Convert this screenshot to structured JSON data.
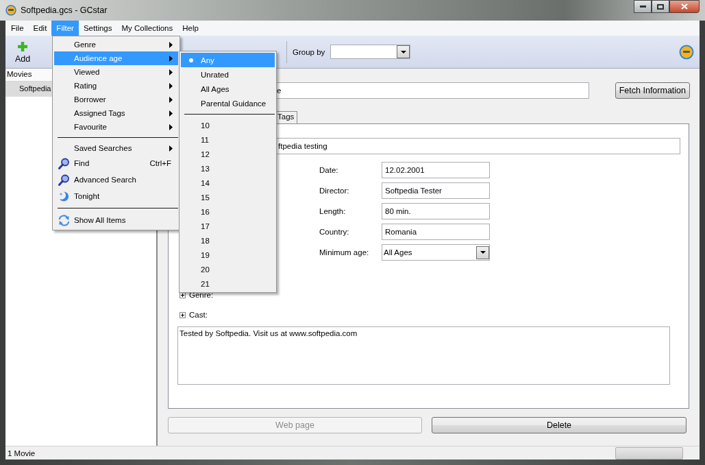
{
  "window": {
    "title": "Softpedia.gcs - GCstar"
  },
  "menu_bar": [
    {
      "label": "File",
      "selected": false
    },
    {
      "label": "Edit",
      "selected": false
    },
    {
      "label": "Filter",
      "selected": true
    },
    {
      "label": "Settings",
      "selected": false
    },
    {
      "label": "My Collections",
      "selected": false
    },
    {
      "label": "Help",
      "selected": false
    }
  ],
  "toolbar": {
    "add_label": "Add",
    "group_by_label": "Group by"
  },
  "sidebar": {
    "header": "Movies",
    "items": [
      {
        "label": "Softpedia",
        "selected": true
      }
    ]
  },
  "filter_menu": [
    {
      "kind": "submenu",
      "label": "Genre",
      "selected": false
    },
    {
      "kind": "submenu",
      "label": "Audience age",
      "selected": true
    },
    {
      "kind": "submenu",
      "label": "Viewed",
      "selected": false
    },
    {
      "kind": "submenu",
      "label": "Rating",
      "selected": false
    },
    {
      "kind": "submenu",
      "label": "Borrower",
      "selected": false
    },
    {
      "kind": "submenu",
      "label": "Assigned Tags",
      "selected": false
    },
    {
      "kind": "submenu",
      "label": "Favourite",
      "selected": false
    },
    {
      "kind": "separator"
    },
    {
      "kind": "submenu",
      "label": "Saved Searches",
      "selected": false
    },
    {
      "kind": "action",
      "label": "Find",
      "shortcut": "Ctrl+F",
      "selected": false
    },
    {
      "kind": "action",
      "label": "Advanced Search",
      "selected": false
    },
    {
      "kind": "action",
      "label": "Tonight",
      "selected": false
    },
    {
      "kind": "separator"
    },
    {
      "kind": "action",
      "label": "Show All Items",
      "selected": false
    }
  ],
  "age_submenu": [
    {
      "kind": "radio",
      "label": "Any",
      "selected": true
    },
    {
      "kind": "radio",
      "label": "Unrated",
      "selected": false
    },
    {
      "kind": "radio",
      "label": "All Ages",
      "selected": false
    },
    {
      "kind": "radio",
      "label": "Parental Guidance",
      "selected": false
    },
    {
      "kind": "separator"
    },
    {
      "kind": "radio",
      "label": "10",
      "selected": false
    },
    {
      "kind": "radio",
      "label": "11",
      "selected": false
    },
    {
      "kind": "radio",
      "label": "12",
      "selected": false
    },
    {
      "kind": "radio",
      "label": "13",
      "selected": false
    },
    {
      "kind": "radio",
      "label": "14",
      "selected": false
    },
    {
      "kind": "radio",
      "label": "15",
      "selected": false
    },
    {
      "kind": "radio",
      "label": "16",
      "selected": false
    },
    {
      "kind": "radio",
      "label": "17",
      "selected": false
    },
    {
      "kind": "radio",
      "label": "18",
      "selected": false
    },
    {
      "kind": "radio",
      "label": "19",
      "selected": false
    },
    {
      "kind": "radio",
      "label": "20",
      "selected": false
    },
    {
      "kind": "radio",
      "label": "21",
      "selected": false
    }
  ],
  "details": {
    "title_value": "e",
    "fetch_button": "Fetch Information",
    "tabs": [
      {
        "label": "Tags",
        "selected": false
      }
    ],
    "subtitle_value": "ftpedia testing",
    "fields": [
      {
        "kind": "text",
        "label": "Date:",
        "value": "12.02.2001"
      },
      {
        "kind": "text",
        "label": "Director:",
        "value": "Softpedia Tester"
      },
      {
        "kind": "text",
        "label": "Length:",
        "value": "80 min."
      },
      {
        "kind": "text",
        "label": "Country:",
        "value": "Romania"
      },
      {
        "kind": "select",
        "label": "Minimum age:",
        "value": "All Ages"
      }
    ],
    "expanders": [
      {
        "label": "Genre:",
        "expanded": false
      },
      {
        "label": "Cast:",
        "expanded": false
      }
    ],
    "comments": "Tested by Softpedia. Visit us at www.softpedia.com",
    "buttons": [
      {
        "label": "Web page",
        "disabled": true
      },
      {
        "label": "Delete",
        "disabled": false
      }
    ]
  },
  "status_bar": {
    "text": "1 Movie",
    "progress": {
      "level": 0
    }
  }
}
